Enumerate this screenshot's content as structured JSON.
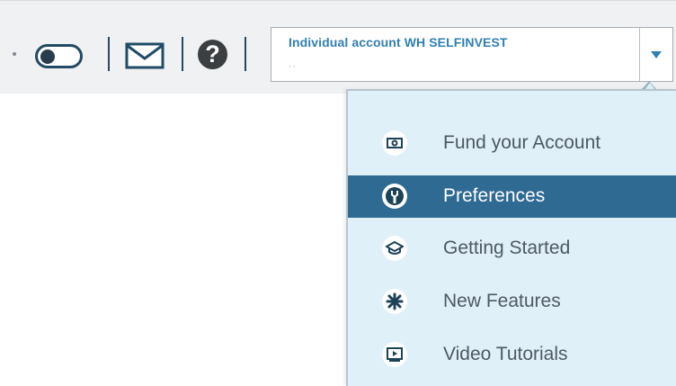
{
  "toolbar": {
    "account_name": "Individual account WH SELFINVEST",
    "account_sub": "-          -",
    "help_label": "?"
  },
  "menu": {
    "items": [
      {
        "label": "Fund your Account",
        "icon": "money-icon"
      },
      {
        "label": "Preferences",
        "icon": "wrench-icon"
      },
      {
        "label": "Getting Started",
        "icon": "graduation-cap-icon"
      },
      {
        "label": "New Features",
        "icon": "sparkle-icon"
      },
      {
        "label": "Video Tutorials",
        "icon": "video-icon"
      }
    ],
    "active_index": 1
  },
  "colors": {
    "accent": "#2f6a93",
    "link": "#2f7fb3",
    "panel_bg": "#dff0f9",
    "icon_dark": "#1d4358"
  }
}
